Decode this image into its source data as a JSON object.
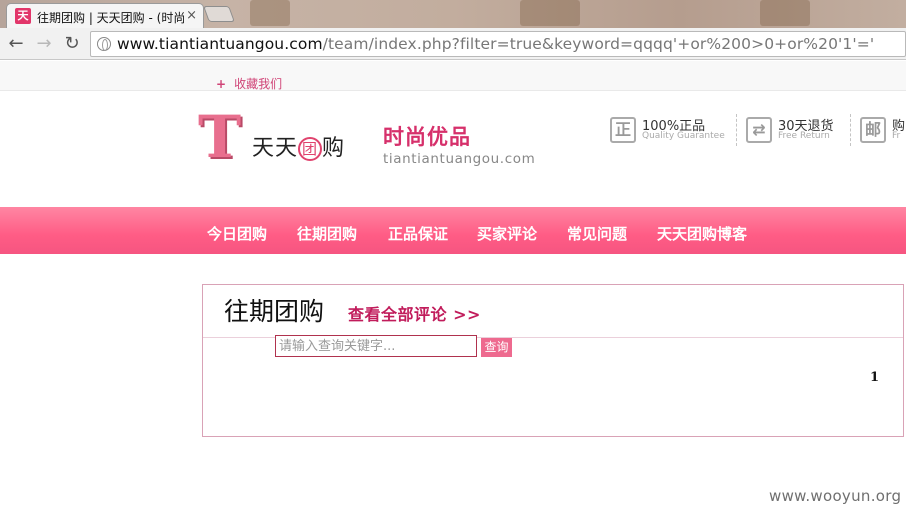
{
  "browser": {
    "tab_title": "往期团购 | 天天团购 - (时尚",
    "tab_favicon_char": "天",
    "tab_close": "×",
    "url_host": "www.tiantiantuangou.com",
    "url_path": "/team/index.php?filter=true&keyword=qqqq'+or%200>0+or%20'1'='",
    "back_icon": "arrow-back-icon",
    "forward_icon": "arrow-forward-icon",
    "reload_icon": "reload-icon"
  },
  "topbar": {
    "favorite_plus": "+",
    "favorite_label": "收藏我们"
  },
  "header": {
    "logo_letter": "T",
    "logo_name_1": "天天",
    "logo_name_tuan": "团",
    "logo_name_2": "购",
    "slogan": "时尚优品",
    "domain": "tiantiantuangou.com",
    "features": [
      {
        "icon": "正",
        "title": "100%正品",
        "subtitle": "Quality Guarantee"
      },
      {
        "icon": "⇄",
        "title": "30天退货",
        "subtitle": "Free Return"
      },
      {
        "icon": "邮",
        "title": "购",
        "subtitle": "Fr"
      }
    ]
  },
  "nav": {
    "items": [
      "今日团购",
      "往期团购",
      "正品保证",
      "买家评论",
      "常见问题",
      "天天团购博客"
    ]
  },
  "main": {
    "title": "往期团购",
    "link": "查看全部评论 >>",
    "search_placeholder": "请输入查询关键字...",
    "search_button": "查询",
    "page_number": "1"
  },
  "watermark": "www.wooyun.org",
  "colors": {
    "brand_pink": "#ff5c85",
    "link_magenta": "#c11c5b"
  }
}
